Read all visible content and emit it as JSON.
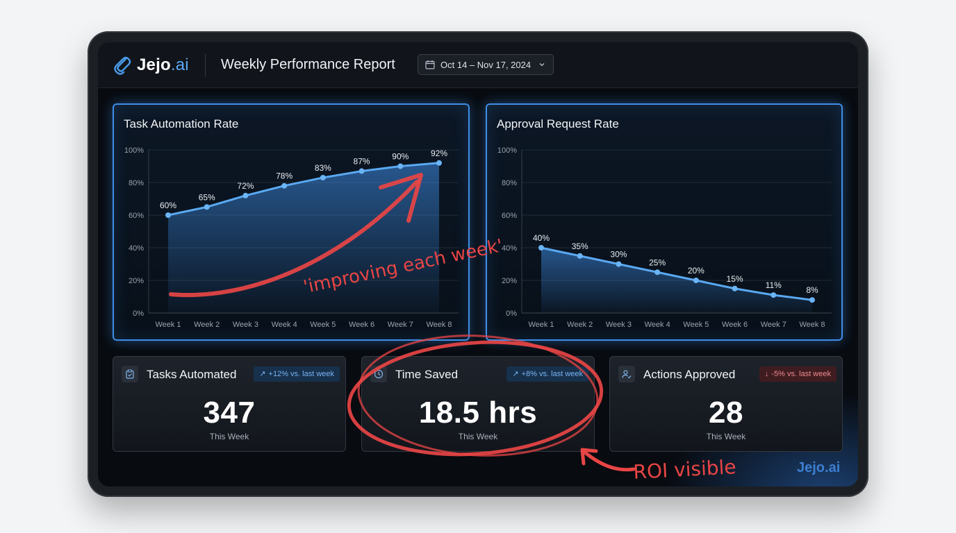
{
  "brand": {
    "name_main": "Jejo",
    "name_accent": ".ai"
  },
  "header": {
    "title": "Weekly Performance Report",
    "date_range": "Oct 14 – Nov 17, 2024"
  },
  "colors": {
    "accent": "#3f8ee8",
    "line": "#5aa9f2",
    "annotation": "#e84545",
    "negative": "#f08b8f"
  },
  "charts": {
    "automation": {
      "title": "Task Automation Rate",
      "y_ticks": [
        "0%",
        "20%",
        "40%",
        "60%",
        "80%",
        "100%"
      ],
      "categories": [
        "Week 1",
        "Week 2",
        "Week 3",
        "Week 4",
        "Week 5",
        "Week 6",
        "Week 7",
        "Week 8"
      ],
      "data_labels": [
        "60%",
        "65%",
        "72%",
        "78%",
        "83%",
        "87%",
        "90%",
        "92%"
      ]
    },
    "approval": {
      "title": "Approval Request Rate",
      "y_ticks": [
        "0%",
        "20%",
        "40%",
        "60%",
        "80%",
        "100%"
      ],
      "categories": [
        "Week 1",
        "Week 2",
        "Week 3",
        "Week 4",
        "Week 5",
        "Week 6",
        "Week 7",
        "Week 8"
      ],
      "data_labels": [
        "40%",
        "35%",
        "30%",
        "25%",
        "20%",
        "15%",
        "11%",
        "8%"
      ]
    }
  },
  "chart_data": [
    {
      "type": "area",
      "title": "Task Automation Rate",
      "categories": [
        "Week 1",
        "Week 2",
        "Week 3",
        "Week 4",
        "Week 5",
        "Week 6",
        "Week 7",
        "Week 8"
      ],
      "values": [
        60,
        65,
        72,
        78,
        83,
        87,
        90,
        92
      ],
      "ylim": [
        0,
        100
      ],
      "grid": true
    },
    {
      "type": "area",
      "title": "Approval Request Rate",
      "categories": [
        "Week 1",
        "Week 2",
        "Week 3",
        "Week 4",
        "Week 5",
        "Week 6",
        "Week 7",
        "Week 8"
      ],
      "values": [
        40,
        35,
        30,
        25,
        20,
        15,
        11,
        8
      ],
      "ylim": [
        0,
        100
      ],
      "grid": true
    }
  ],
  "cards": [
    {
      "label": "Tasks Automated",
      "badge": "+12% vs. last week",
      "trend": "up",
      "value": "347",
      "sub": "This Week",
      "icon": "clipboard-icon"
    },
    {
      "label": "Time Saved",
      "badge": "+8% vs. last week",
      "trend": "up",
      "value": "18.5 hrs",
      "sub": "This Week",
      "icon": "clock-icon"
    },
    {
      "label": "Actions Approved",
      "badge": "-5% vs. last week",
      "trend": "down",
      "value": "28",
      "sub": "This Week",
      "icon": "user-check-icon"
    }
  ],
  "annotations": {
    "arrow_note": "'improving each week'",
    "roi_note": "ROI visible"
  },
  "watermark": "Jejo.ai"
}
